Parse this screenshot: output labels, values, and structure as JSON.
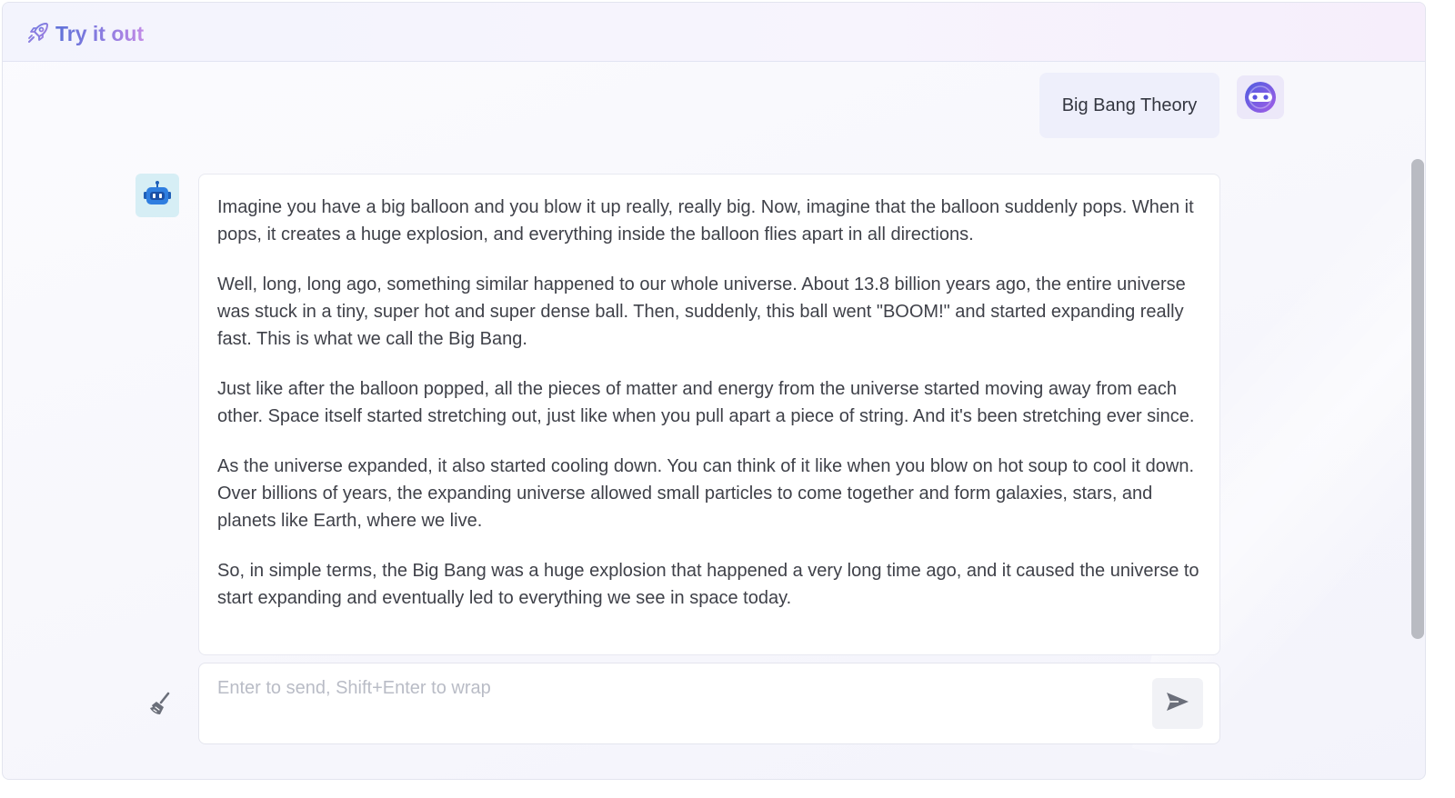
{
  "header": {
    "title": "Try it out",
    "icon": "rocket-icon",
    "title_gradient": [
      "#5f72d8",
      "#c18ae6"
    ]
  },
  "conversation": {
    "user_message": "Big Bang Theory",
    "user_avatar_icon": "user-avatar-icon",
    "bot_avatar_icon": "robot-icon",
    "answer_paragraphs": [
      "Imagine you have a big balloon and you blow it up really, really big. Now, imagine that the balloon suddenly pops. When it pops, it creates a huge explosion, and everything inside the balloon flies apart in all directions.",
      "Well, long, long ago, something similar happened to our whole universe. About 13.8 billion years ago, the entire universe was stuck in a tiny, super hot and super dense ball. Then, suddenly, this ball went \"BOOM!\" and started expanding really fast. This is what we call the Big Bang.",
      "Just like after the balloon popped, all the pieces of matter and energy from the universe started moving away from each other. Space itself started stretching out, just like when you pull apart a piece of string. And it's been stretching ever since.",
      "As the universe expanded, it also started cooling down. You can think of it like when you blow on hot soup to cool it down. Over billions of years, the expanding universe allowed small particles to come together and form galaxies, stars, and planets like Earth, where we live.",
      "So, in simple terms, the Big Bang was a huge explosion that happened a very long time ago, and it caused the universe to start expanding and eventually led to everything we see in space today."
    ]
  },
  "composer": {
    "placeholder": "Enter to send, Shift+Enter to wrap",
    "value": "",
    "clear_icon": "broom-icon",
    "send_icon": "send-icon"
  },
  "colors": {
    "accent": "#5f72d8",
    "bot_avatar_bg": "#d6eef5",
    "user_bubble_bg": "#eeeffb"
  }
}
